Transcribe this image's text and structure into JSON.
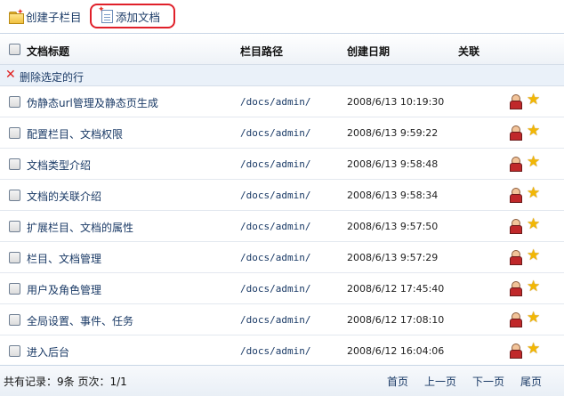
{
  "toolbar": {
    "create_label": "创建子栏目",
    "add_label": "添加文档"
  },
  "header": {
    "title": "文档标题",
    "path": "栏目路径",
    "date": "创建日期",
    "related": "关联"
  },
  "delete_label": "删除选定的行",
  "rows": [
    {
      "title": "伪静态url管理及静态页生成",
      "path": "/docs/admin/",
      "date": "2008/6/13  10:19:30"
    },
    {
      "title": "配置栏目、文档权限",
      "path": "/docs/admin/",
      "date": "2008/6/13  9:59:22"
    },
    {
      "title": "文档类型介绍",
      "path": "/docs/admin/",
      "date": "2008/6/13  9:58:48"
    },
    {
      "title": "文档的关联介绍",
      "path": "/docs/admin/",
      "date": "2008/6/13  9:58:34"
    },
    {
      "title": "扩展栏目、文档的属性",
      "path": "/docs/admin/",
      "date": "2008/6/13  9:57:50"
    },
    {
      "title": "栏目、文档管理",
      "path": "/docs/admin/",
      "date": "2008/6/13  9:57:29"
    },
    {
      "title": "用户及角色管理",
      "path": "/docs/admin/",
      "date": "2008/6/12  17:45:40"
    },
    {
      "title": "全局设置、事件、任务",
      "path": "/docs/admin/",
      "date": "2008/6/12  17:08:10"
    },
    {
      "title": "进入后台",
      "path": "/docs/admin/",
      "date": "2008/6/12  16:04:06"
    }
  ],
  "footer": {
    "info": "共有记录：9条   页次：1/1",
    "first": "首页",
    "prev": "上一页",
    "next": "下一页",
    "last": "尾页"
  }
}
